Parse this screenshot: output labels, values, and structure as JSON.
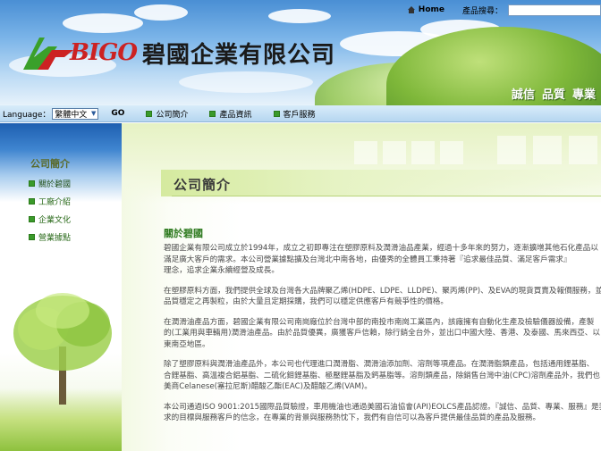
{
  "topbar": {
    "home_label": "Home",
    "search_label": "產品搜尋：",
    "search_value": ""
  },
  "logo": {
    "latin": "BIGO",
    "chinese": "碧國企業有限公司"
  },
  "slogan": [
    "誠信",
    "品質",
    "專業"
  ],
  "nav": {
    "language_label": "Language：",
    "language_selected": "繁體中文",
    "go_label": "GO",
    "items": [
      "公司簡介",
      "產品資訊",
      "客戶服務"
    ]
  },
  "sidebar": {
    "title": "公司簡介",
    "items": [
      "關於碧國",
      "工廠介紹",
      "企業文化",
      "營業據點"
    ]
  },
  "main": {
    "title": "公司簡介",
    "section_heading": "關於碧國",
    "paragraphs": [
      [
        "碧國企業有限公司成立於1994年，成立之初即專注在塑膠原料及潤滑油品產業，經過十多年來的努力，逐漸擴增其他石化產品以",
        "滿足廣大客戶的需求。本公司營業據點擴及台灣北中南各地，由優秀的全體員工秉持著『追求最佳品質、滿足客戶需求』",
        "理念，追求企業永續經營及成長。"
      ],
      [
        "在塑膠原料方面，我們提供全球及台灣各大品牌聚乙烯(HDPE、LDPE、LLDPE)、聚丙烯(PP)、及EVA的現貨買賣及報價服務，並",
        "品質穩定之再製粒，由於大量且定期採購，我們可以穩定供應客戶有競爭性的價格。"
      ],
      [
        "在潤滑油產品方面，碧國企業有限公司南崗廠位於台灣中部的南投市南崗工業區內，該廠擁有自動化生產及檢驗儀器設備，產製",
        "的(工業用與車輛用)潤滑油產品。由於品質優異，廣獲客戶信賴，除行銷全台外，並出口中國大陸、香港、及泰國、馬來西亞、以",
        "東南亞地區。"
      ],
      [
        "除了塑膠原料與潤滑油產品外，本公司也代理進口潤滑脂、潤滑油添加劑、溶劑等項產品。在潤滑脂類產品，包括通用鋰基脂、",
        "合鋰基脂、高溫複合鋁基脂、二硫化鉬鋰基脂、極壓鋰基脂及鈣基脂等。溶劑類產品，除銷售台灣中油(CPC)溶劑產品外，我們也",
        "美商Celanese(塞拉尼斯)醋酸乙酯(EAC)及醋酸乙烯(VAM)。"
      ],
      [
        "本公司通過ISO 9001:2015國際品質驗證，車用機油也通過美國石油協會(API)EOLCS產品認證。『誠信、品質、專業、服務』是我",
        "求的目標與服務客戶的信念，在專業的背景與服務熱忱下，我們有自信可以為客戶提供最佳品質的產品及服務。"
      ]
    ]
  },
  "colors": {
    "nav_bg": "#c6e0f5",
    "sidebar_link": "#2a6a1a",
    "heading_green": "#2e7a1f",
    "logo_red": "#cc2222"
  }
}
